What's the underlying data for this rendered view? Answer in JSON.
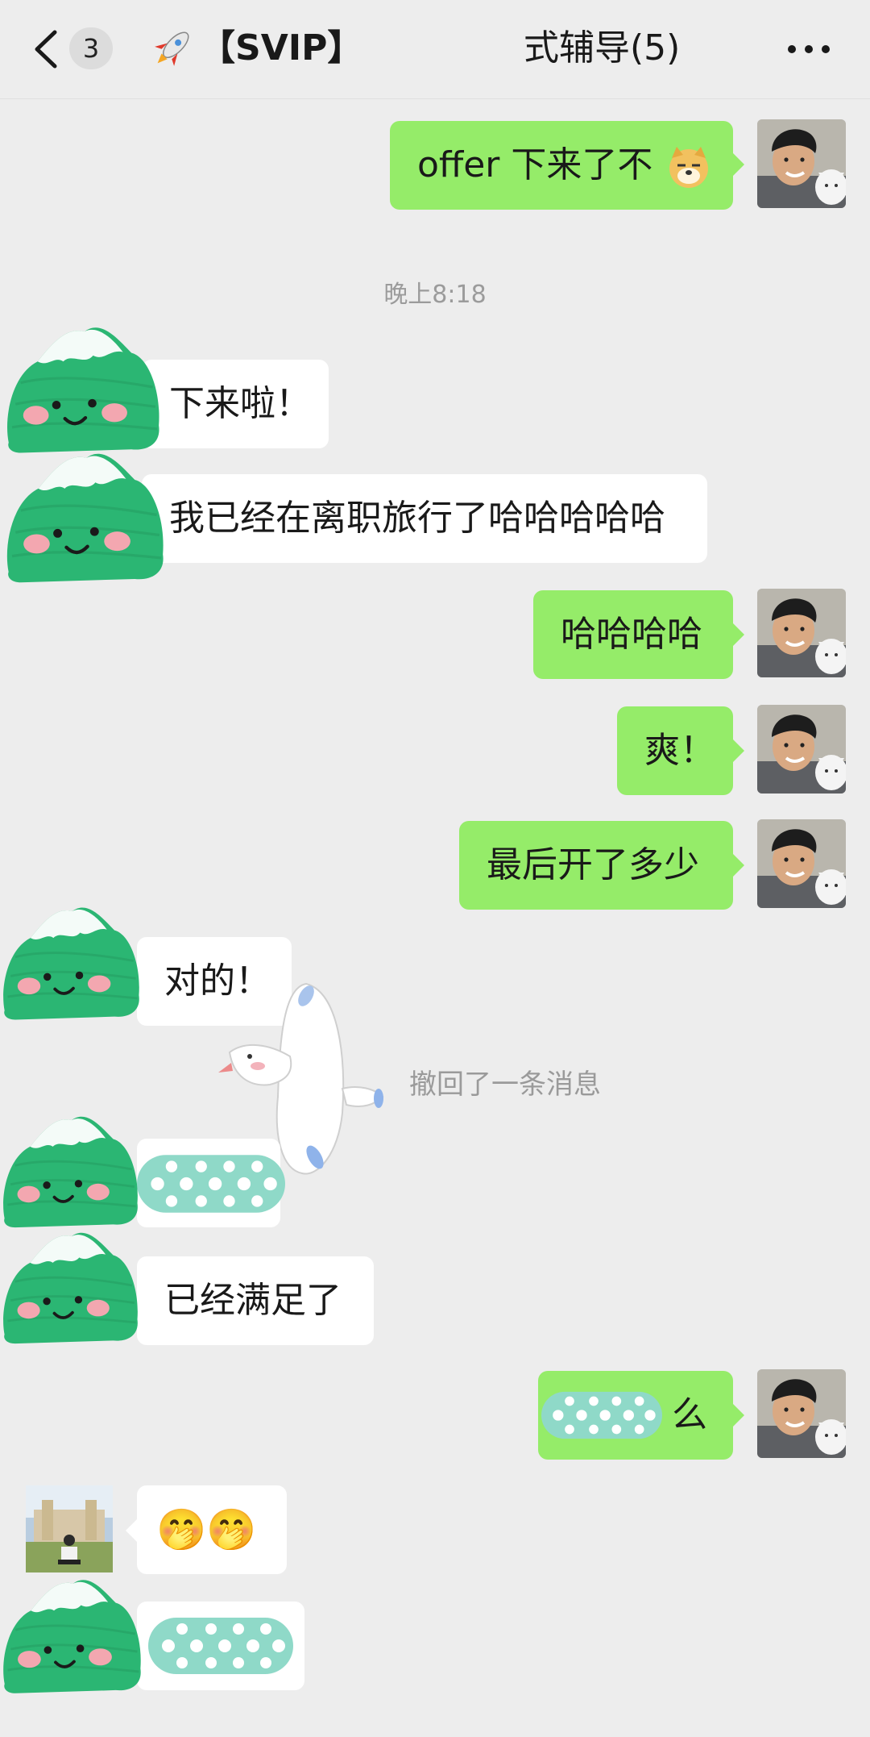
{
  "header": {
    "unread_count": "3",
    "title_part1": "【SVIP】",
    "title_part2": "式辅导(5)",
    "rocket_icon": "rocket-emoji",
    "more_icon": "ellipsis"
  },
  "messages": {
    "m1": "offer 下来了不",
    "time1": "晚上8:18",
    "m2": "下来啦！",
    "m3": "我已经在离职旅行了哈哈哈哈哈",
    "m4": "哈哈哈哈",
    "m5": "爽！",
    "m6": "最后开了多少",
    "m7": "对的！",
    "recall": "撤回了一条消息",
    "m9": "已经满足了",
    "m10_suffix": "么",
    "m11_emojis": "🤭🤭"
  },
  "colors": {
    "green_bubble": "#95ec69",
    "background": "#ededed",
    "sticker_green": "#2eb872"
  }
}
